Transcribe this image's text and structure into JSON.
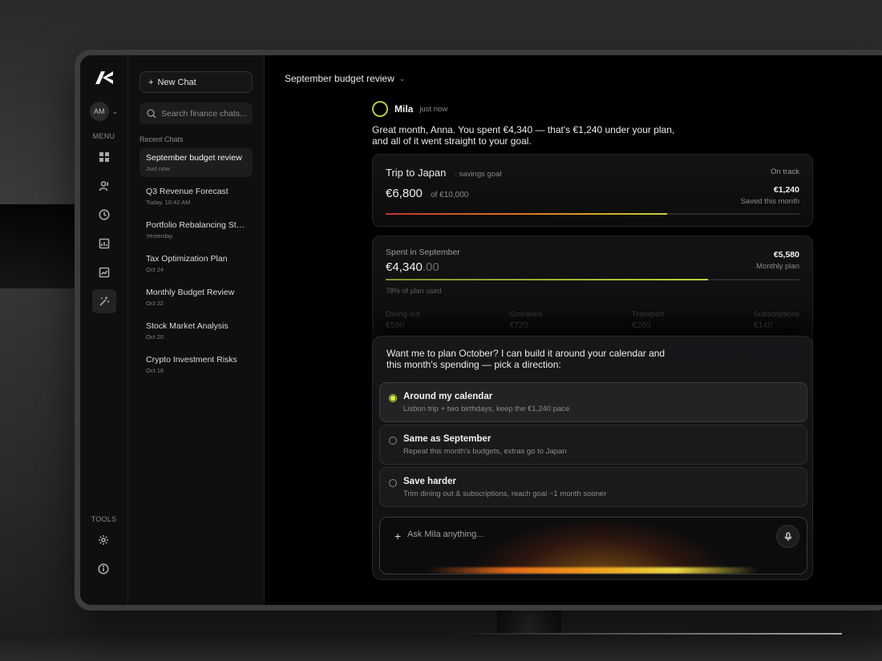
{
  "sidebar": {
    "avatar_initials": "AM",
    "menu_label": "MENU",
    "tools_label": "TOOLS",
    "menu_icons": [
      "dashboard-icon",
      "users-icon",
      "clock-icon",
      "report-icon",
      "chart-icon",
      "ai-tools-icon"
    ],
    "tool_icons": [
      "gear-icon",
      "info-icon"
    ]
  },
  "chatlist": {
    "new_chat_label": "New Chat",
    "search_placeholder": "Search finance chats...",
    "recent_label": "Recent Chats",
    "items": [
      {
        "title": "September budget review",
        "date": "Just now"
      },
      {
        "title": "Q3 Revenue Forecast",
        "date": "Today, 10:42 AM"
      },
      {
        "title": "Portfolio Rebalancing Strat...",
        "date": "Yesterday"
      },
      {
        "title": "Tax Optimization Plan",
        "date": "Oct 24"
      },
      {
        "title": "Monthly Budget Review",
        "date": "Oct 22"
      },
      {
        "title": "Stock Market Analysis",
        "date": "Oct 20"
      },
      {
        "title": "Crypto Investment Risks",
        "date": "Oct 18"
      }
    ]
  },
  "main": {
    "conversation_title": "September budget review",
    "sender": "Mila",
    "sender_time": "just now",
    "message": "Great month, Anna. You spent €4,340 — that's €1,240 under your plan, and all of it went straight to your goal.",
    "goal": {
      "title": "Trip to Japan",
      "subtitle": "· savings goal",
      "status": "On track",
      "amount": "€6,800",
      "target": "of €10,000",
      "saved_value": "€1,240",
      "saved_label": "Saved this month",
      "progress": 0.68
    },
    "spending": {
      "label": "Spent in September",
      "amount_main": "€4,340",
      "amount_decimals": ".00",
      "plan_value": "€5,580",
      "plan_label": "Monthly plan",
      "used_text": "78% of plan used",
      "progress": 0.78,
      "categories": [
        {
          "name": "Dining out",
          "value": "€590"
        },
        {
          "name": "Groceries",
          "value": "€720"
        },
        {
          "name": "Transport",
          "value": "€260"
        },
        {
          "name": "Subscriptions",
          "value": "€140"
        }
      ]
    },
    "prompt": "Want me to plan October? I can build it around your calendar and this month's spending — pick a direction:",
    "options": [
      {
        "title": "Around my calendar",
        "desc": "Lisbon trip + two birthdays, keep the €1,240 pace",
        "selected": true
      },
      {
        "title": "Same as September",
        "desc": "Repeat this month's budgets, extras go to Japan",
        "selected": false
      },
      {
        "title": "Save harder",
        "desc": "Trim dining out & subscriptions, reach goal ~1 month sooner",
        "selected": false
      }
    ],
    "composer_placeholder": "Ask Mila anything...",
    "accent_color": "#c8e03b"
  }
}
